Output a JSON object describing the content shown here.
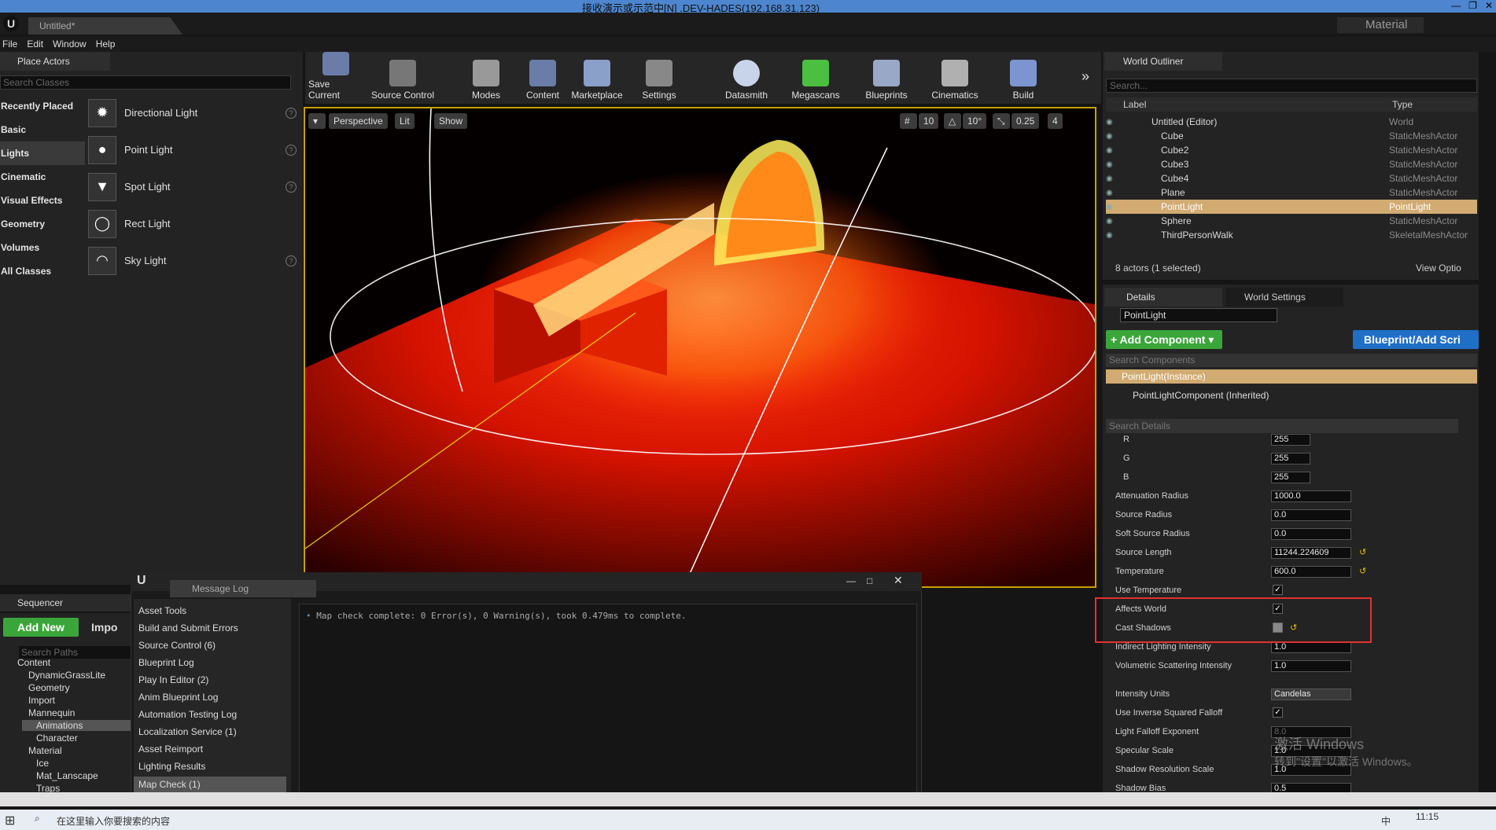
{
  "rdp": {
    "title": "接收演示或示范中[N] .DEV-HADES(192.168.31.123)"
  },
  "window": {
    "tab": "Untitled*",
    "mode": "Material"
  },
  "menu": [
    "File",
    "Edit",
    "Window",
    "Help"
  ],
  "place_actors": {
    "tab": "Place Actors",
    "search_placeholder": "Search Classes",
    "categories": [
      "Recently Placed",
      "Basic",
      "Lights",
      "Cinematic",
      "Visual Effects",
      "Geometry",
      "Volumes",
      "All Classes"
    ],
    "selected_category": "Lights",
    "actors": [
      "Directional Light",
      "Point Light",
      "Spot Light",
      "Rect Light",
      "Sky Light"
    ]
  },
  "toolbar": {
    "buttons": [
      "Save Current",
      "Source Control",
      "Modes",
      "Content",
      "Marketplace",
      "Settings",
      "Datasmith",
      "Megascans",
      "Blueprints",
      "Cinematics",
      "Build"
    ]
  },
  "viewport": {
    "perspective": "Perspective",
    "lit": "Lit",
    "show": "Show",
    "grid": "10",
    "rotation": "10°",
    "scale": "0.25",
    "camera_speed": "4"
  },
  "outliner": {
    "tab": "World Outliner",
    "search_placeholder": "Search...",
    "col_label": "Label",
    "col_type": "Type",
    "root": {
      "label": "Untitled (Editor)",
      "type": "World"
    },
    "items": [
      {
        "label": "Cube",
        "type": "StaticMeshActor"
      },
      {
        "label": "Cube2",
        "type": "StaticMeshActor"
      },
      {
        "label": "Cube3",
        "type": "StaticMeshActor"
      },
      {
        "label": "Cube4",
        "type": "StaticMeshActor"
      },
      {
        "label": "Plane",
        "type": "StaticMeshActor"
      },
      {
        "label": "PointLight",
        "type": "PointLight"
      },
      {
        "label": "Sphere",
        "type": "StaticMeshActor"
      },
      {
        "label": "ThirdPersonWalk",
        "type": "SkeletalMeshActor"
      }
    ],
    "selected": "PointLight",
    "count": "8 actors (1 selected)",
    "view_options": "View Optio"
  },
  "details": {
    "tab": "Details",
    "world_settings_tab": "World Settings",
    "name": "PointLight",
    "add_component": "+ Add Component ▾",
    "blueprint": "Blueprint/Add Scri",
    "search_components": "Search Components",
    "component_instance": "PointLight(Instance)",
    "component_inherited": "PointLightComponent (Inherited)",
    "search_details": "Search Details",
    "props": [
      {
        "label": "R",
        "value": "255"
      },
      {
        "label": "G",
        "value": "255"
      },
      {
        "label": "B",
        "value": "255"
      },
      {
        "label": "Attenuation Radius",
        "value": "1000.0"
      },
      {
        "label": "Source Radius",
        "value": "0.0"
      },
      {
        "label": "Soft Source Radius",
        "value": "0.0"
      },
      {
        "label": "Source Length",
        "value": "11244.224609"
      },
      {
        "label": "Temperature",
        "value": "600.0"
      },
      {
        "label": "Use Temperature",
        "check": true
      },
      {
        "label": "Affects World",
        "check": true
      },
      {
        "label": "Cast Shadows",
        "check": false
      },
      {
        "label": "Indirect Lighting Intensity",
        "value": "1.0"
      },
      {
        "label": "Volumetric Scattering Intensity",
        "value": "1.0"
      },
      {
        "label": "Intensity Units",
        "value": "Candelas"
      },
      {
        "label": "Use Inverse Squared Falloff",
        "check": true
      },
      {
        "label": "Light Falloff Exponent",
        "value": "8.0"
      },
      {
        "label": "Specular Scale",
        "value": "1.0"
      },
      {
        "label": "Shadow Resolution Scale",
        "value": "1.0"
      },
      {
        "label": "Shadow Bias",
        "value": "0.5"
      }
    ],
    "watermark_1": "激活 Windows",
    "watermark_2": "转到\"设置\"以激活 Windows。"
  },
  "content_browser": {
    "sequencer_tab": "Sequencer",
    "add_new": "Add New",
    "import": "Impo",
    "search_paths": "Search Paths",
    "tree": [
      "Content",
      "DynamicGrassLite",
      "Geometry",
      "Import",
      "Mannequin",
      "Animations",
      "Character",
      "Material",
      "Ice",
      "Mat_Lanscape",
      "Traps"
    ],
    "selected": "Animations"
  },
  "message_log": {
    "tab": "Message Log",
    "categories": [
      "Asset Tools",
      "Build and Submit Errors",
      "Source Control (6)",
      "Blueprint Log",
      "Play In Editor (2)",
      "Anim Blueprint Log",
      "Automation Testing Log",
      "Localization Service (1)",
      "Asset Reimport",
      "Lighting Results",
      "Map Check (1)"
    ],
    "selected": "Map Check (1)",
    "message": "Map check complete: 0 Error(s), 0 Warning(s), took 0.479ms to complete."
  },
  "taskbar": {
    "search": "在这里输入你要搜索的内容",
    "time": "11:15",
    "ime": "中"
  }
}
